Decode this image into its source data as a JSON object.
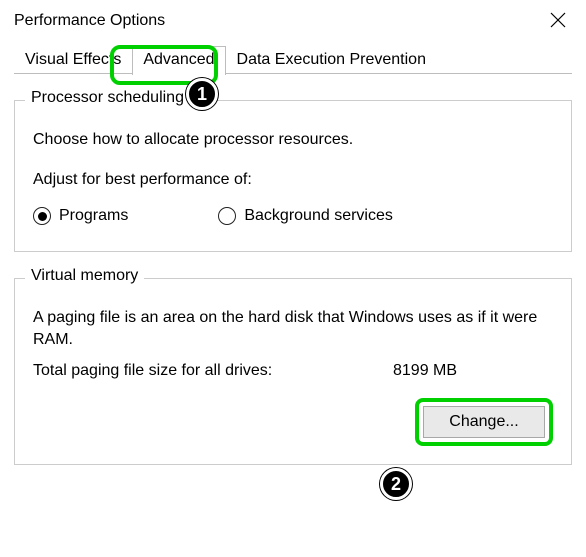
{
  "window": {
    "title": "Performance Options"
  },
  "tabs": {
    "visual_effects": "Visual Effects",
    "advanced": "Advanced",
    "dep": "Data Execution Prevention"
  },
  "processor_group": {
    "title": "Processor scheduling",
    "desc": "Choose how to allocate processor resources.",
    "adjust_label": "Adjust for best performance of:",
    "option_programs": "Programs",
    "option_background": "Background services"
  },
  "vm_group": {
    "title": "Virtual memory",
    "desc": "A paging file is an area on the hard disk that Windows uses as if it were RAM.",
    "total_label": "Total paging file size for all drives:",
    "total_value": "8199 MB",
    "change_btn": "Change..."
  },
  "callouts": {
    "one": "1",
    "two": "2"
  }
}
